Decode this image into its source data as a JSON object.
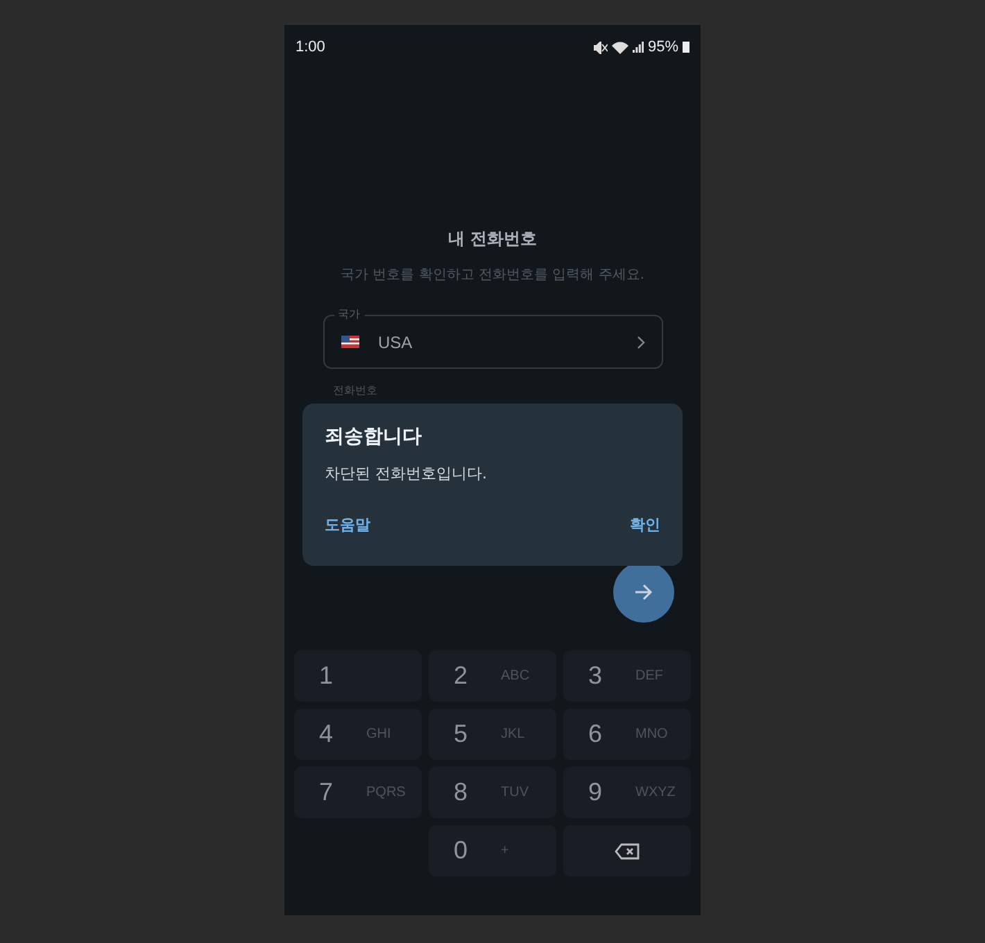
{
  "status_bar": {
    "time": "1:00",
    "battery": "95%"
  },
  "title": "내 전화번호",
  "subtitle": "국가 번호를 확인하고 전화번호를 입력해 주세요.",
  "country_field": {
    "label": "국가",
    "value": "USA"
  },
  "phone_field": {
    "label": "전화번호"
  },
  "dialog": {
    "title": "죄송합니다",
    "message": "차단된 전화번호입니다.",
    "buttons": [
      "도움말",
      "확인"
    ]
  },
  "keypad": [
    {
      "kind": "digit",
      "digit": "1"
    },
    {
      "kind": "digit",
      "digit": "2",
      "letters": "ABC"
    },
    {
      "kind": "digit",
      "digit": "3",
      "letters": "DEF"
    },
    {
      "kind": "digit",
      "digit": "4",
      "letters": "GHI"
    },
    {
      "kind": "digit",
      "digit": "5",
      "letters": "JKL"
    },
    {
      "kind": "digit",
      "digit": "6",
      "letters": "MNO"
    },
    {
      "kind": "digit",
      "digit": "7",
      "letters": "PQRS"
    },
    {
      "kind": "digit",
      "digit": "8",
      "letters": "TUV"
    },
    {
      "kind": "digit",
      "digit": "9",
      "letters": "WXYZ"
    },
    {
      "kind": "blank"
    },
    {
      "kind": "digit",
      "digit": "0",
      "letters": "+"
    },
    {
      "kind": "backspace"
    }
  ]
}
